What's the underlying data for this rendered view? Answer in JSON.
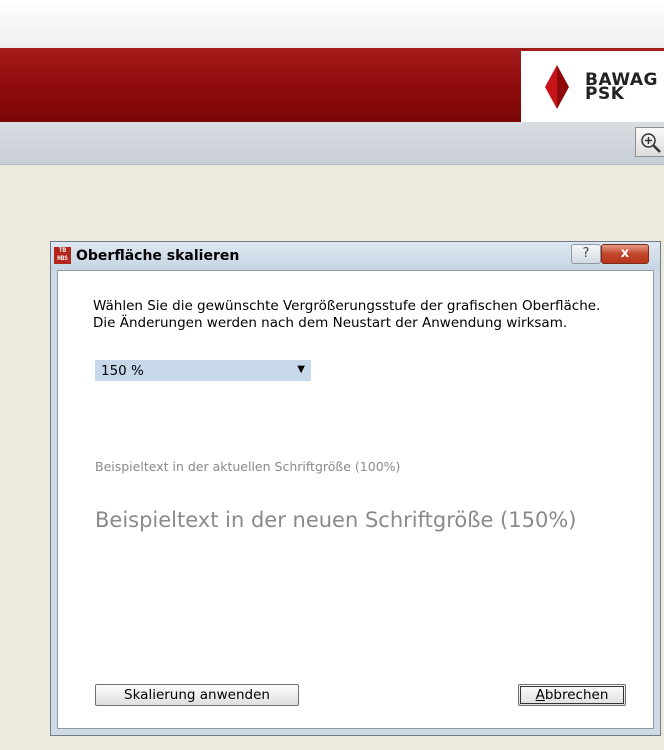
{
  "header": {
    "logo_text_line1": "BAWAG",
    "logo_text_line2": "PSK",
    "brand_color": "#8e0b0b"
  },
  "toolbar": {
    "zoom_icon": "zoom-in-icon"
  },
  "dialog": {
    "title": "Oberfläche skalieren",
    "app_icon_text_top": "TB",
    "app_icon_text_bottom": "HBS",
    "help_glyph": "?",
    "close_glyph": "x",
    "description": "Wählen Sie die gewünschte Vergrößerungsstufe der grafischen Oberfläche. Die Änderungen werden nach dem Neustart der Anwendung wirksam.",
    "scale_select": {
      "selected": "150 %"
    },
    "sample_current": "Beispieltext in der aktuellen Schriftgröße (100%)",
    "sample_new": "Beispieltext in der neuen Schriftgröße (150%)",
    "apply_label": "Skalierung anwenden",
    "cancel_label": "Abbrechen"
  }
}
